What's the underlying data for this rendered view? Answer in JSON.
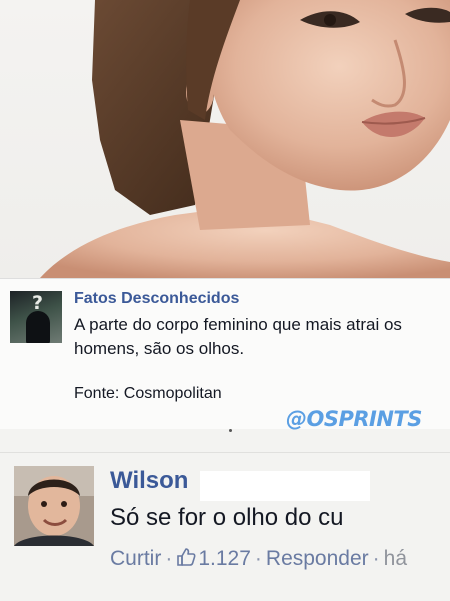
{
  "post": {
    "author": "Fatos Desconhecidos",
    "text": "A parte do corpo feminino que mais atrai os homens, são os olhos.",
    "source": "Fonte: Cosmopolitan",
    "avatar_icon": "question-mark-avatar"
  },
  "watermark": "@OSPRINTS",
  "comment": {
    "author": "Wilson",
    "text": "Só se for o olho do cu",
    "actions": {
      "like": "Curtir",
      "reply": "Responder",
      "time": "há",
      "reaction_count": "1.127",
      "reaction_icon": "thumbs-up-icon"
    }
  },
  "colors": {
    "link_blue": "#3b5998",
    "action_blue": "#6a7ba2",
    "watermark_blue": "#5b9fe3",
    "text": "#141823"
  }
}
